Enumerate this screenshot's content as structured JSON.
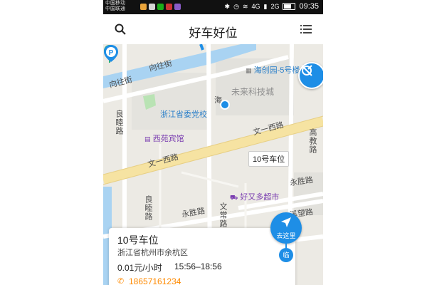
{
  "status_bar": {
    "carrier_1": "中国移动",
    "carrier_2": "中国联通",
    "network": "4G",
    "network_2": "2G",
    "time": "09:35"
  },
  "app_header": {
    "title": "好车好位",
    "search_icon": "search-icon",
    "menu_icon": "list-menu-icon"
  },
  "map": {
    "streets": {
      "xiangwang_street": "向往街",
      "wenyi_west_road_top": "文一西路",
      "wenyi_west_road_left": "文一西路",
      "liangmu_road_top": "良睦路",
      "liangmu_road_bottom": "良睦路",
      "gaojiao_road": "高教路",
      "yongsheng_road_right": "永胜路",
      "yongsheng_road_bottom": "永胜路",
      "wenchang_road": "文常路",
      "xiwang_road": "溪望路",
      "hai_road_fragment": "海"
    },
    "pois": {
      "haichuang_park": "海创园-5号楼",
      "future_tech_city": "未来科技城",
      "party_school": "浙江省委党校",
      "xiyuan_hotel": "西苑宾馆",
      "haoyouduo_market": "好又多超市"
    },
    "selected_marker_label": "10号车位",
    "parking_marker_letter": "P"
  },
  "parking_card": {
    "name": "10号车位",
    "address": "浙江省杭州市余杭区",
    "price": "0.01元/小时",
    "hours": "15:56–18:56",
    "phone": "18657161234"
  },
  "go_here_button": {
    "label": "去这里"
  },
  "nearby_badge": {
    "label": "临"
  },
  "colors": {
    "accent_blue": "#1e8ee6",
    "phone_orange": "#ff8a00",
    "road_yellow": "#f6e3a2",
    "river_blue": "#a9d3f2",
    "park_green": "#b9e3b4"
  }
}
